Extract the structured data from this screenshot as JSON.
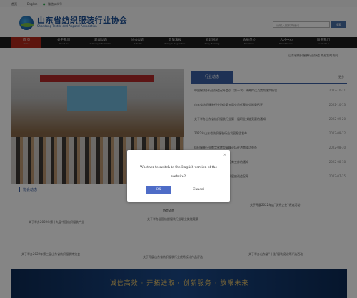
{
  "topbar": {
    "home_label": "首页",
    "english_label": "English",
    "wechat_label": "微信公众号"
  },
  "header": {
    "org_name": "山东省纺织服装行业协会",
    "org_name_en": "Shandong Textile and Apparel Association",
    "search_placeholder": "请输入搜索关键词",
    "search_button": "搜索"
  },
  "nav": {
    "items": [
      {
        "zh": "首 页",
        "en": "Home"
      },
      {
        "zh": "关于我们",
        "en": "About Us"
      },
      {
        "zh": "新闻动态",
        "en": "Industry Information"
      },
      {
        "zh": "协会动态",
        "en": "Activity"
      },
      {
        "zh": "政策法规",
        "en": "Policy & Regulation"
      },
      {
        "zh": "党建园地",
        "en": "Party Building"
      },
      {
        "zh": "会员单位",
        "en": "Members"
      },
      {
        "zh": "人才中心",
        "en": "Talent Center"
      },
      {
        "zh": "联系我们",
        "en": "Contact Us"
      }
    ]
  },
  "notice": {
    "text": "山东省纺织服装行业协会 欢迎您的访问"
  },
  "news": {
    "tab_label": "行业动态",
    "more_label": "更多",
    "items": [
      {
        "title": "中国棉纺织行业协会召开会议（第一次）精神传达及贯彻落实情况",
        "date": "2022-10-21"
      },
      {
        "title": "山东省纺织服装行业协会第五届会员代表大会隆重召开",
        "date": "2022-10-13"
      },
      {
        "title": "关于举办山东省纺织服装行业第一届职业技能竞赛的通知",
        "date": "2022-09-20"
      },
      {
        "title": "2022年山东省纺织服装行业发展报告发布",
        "date": "2022-09-12"
      },
      {
        "title": "纺织服装行业数字化转型高峰论坛在济南成功举办",
        "date": "2022-08-30"
      },
      {
        "title": "关于开展纺织服装行业品牌培育工作的通知",
        "date": "2022-08-18"
      },
      {
        "title": "山东纺织服装产业链高质量发展座谈会召开",
        "date": "2022-07-25"
      }
    ]
  },
  "association": {
    "section_title": "协会动态",
    "cards": [
      {
        "tag": "",
        "text": "关于举办2022年第十九届中国纺织服装产业"
      },
      {
        "tag": "协会动态",
        "text": "关于举办全国纺织服装行业职业技能竞赛"
      },
      {
        "tag": "",
        "text": "关于开展2022年度“优秀企业”评选活动"
      }
    ],
    "bottom_lines": [
      "关于举办2022年第三届山东省纺织服装博览会",
      "关于开展山东省纺织服装行业优秀设计作品评选",
      "关于举办山东省“十佳”服装设计师评选活动"
    ]
  },
  "slogan": "诚信高效 · 开拓进取 · 创新服务 · 放眼未来",
  "dialog": {
    "close_label": "×",
    "message": "Whether to switch to the English version of the website?",
    "ok_label": "OK",
    "cancel_label": "Cancel"
  }
}
